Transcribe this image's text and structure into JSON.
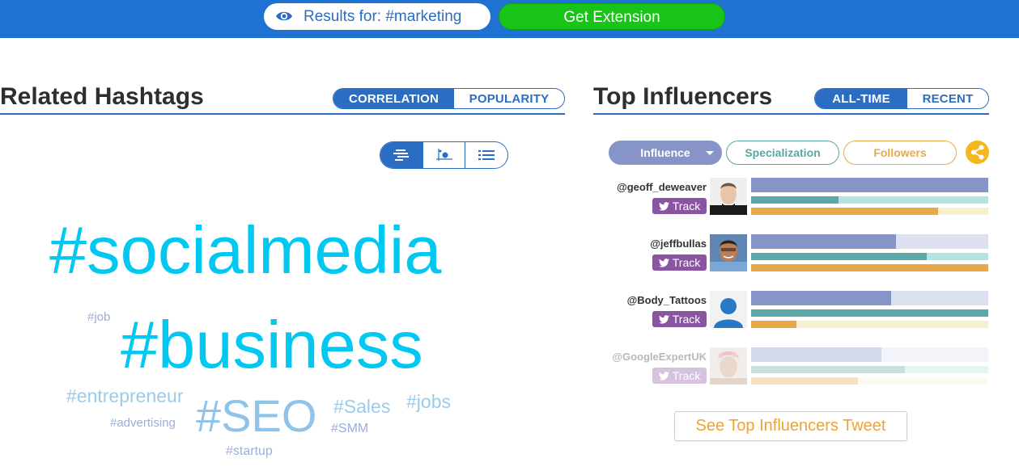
{
  "header": {
    "results_label": "Results for: #marketing",
    "extension_button": "Get Extension"
  },
  "related": {
    "title": "Related Hashtags",
    "tabs": [
      {
        "label": "CORRELATION",
        "active": true
      },
      {
        "label": "POPULARITY",
        "active": false
      }
    ],
    "view_modes": [
      "cloud-view-icon",
      "scatter-view-icon",
      "list-view-icon"
    ],
    "hashtags": [
      {
        "text": "#socialmedia",
        "color": "#00c8f0"
      },
      {
        "text": "#business",
        "color": "#00c8f0"
      },
      {
        "text": "#job",
        "color": "#9aaedc"
      },
      {
        "text": "#entrepreneur",
        "color": "#9ccbea"
      },
      {
        "text": "#SEO",
        "color": "#8fc4ea"
      },
      {
        "text": "#Sales",
        "color": "#9ccbea"
      },
      {
        "text": "#jobs",
        "color": "#9ccbea"
      },
      {
        "text": "#advertising",
        "color": "#9aaedc"
      },
      {
        "text": "#SMM",
        "color": "#9aaedc"
      },
      {
        "text": "#startup",
        "color": "#9aaedc"
      }
    ]
  },
  "influencers": {
    "title": "Top Influencers",
    "tabs": [
      {
        "label": "ALL-TIME",
        "active": true
      },
      {
        "label": "RECENT",
        "active": false
      }
    ],
    "filters": {
      "influence": "Influence",
      "specialization": "Specialization",
      "followers": "Followers"
    },
    "track_label": "Track",
    "rows": [
      {
        "handle": "@geoff_deweaver",
        "influence": 1.0,
        "specialization": 0.37,
        "followers": 0.79
      },
      {
        "handle": "@jeffbullas",
        "influence": 0.61,
        "specialization": 0.74,
        "followers": 1.0
      },
      {
        "handle": "@Body_Tattoos",
        "influence": 0.59,
        "specialization": 1.0,
        "followers": 0.19
      },
      {
        "handle": "@GoogleExpertUK",
        "influence": 0.55,
        "specialization": 0.65,
        "followers": 0.45
      }
    ],
    "see_more_button": "See Top Influencers Tweet"
  },
  "colors": {
    "header_bg": "#1f72d1",
    "accent": "#2b6dc2",
    "cta_green": "#18c418",
    "track_purple": "#8a55a0"
  }
}
